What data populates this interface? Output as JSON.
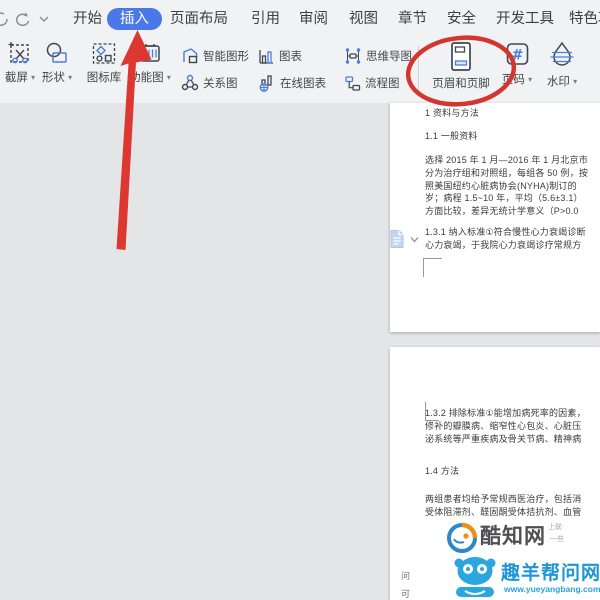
{
  "menubar": {
    "items": [
      {
        "label": "开始",
        "active": false
      },
      {
        "label": "插入",
        "active": true
      },
      {
        "label": "页面布局",
        "active": false
      },
      {
        "label": "引用",
        "active": false
      },
      {
        "label": "审阅",
        "active": false
      },
      {
        "label": "视图",
        "active": false
      },
      {
        "label": "章节",
        "active": false
      },
      {
        "label": "安全",
        "active": false
      },
      {
        "label": "开发工具",
        "active": false
      },
      {
        "label": "特色功能",
        "active": false
      }
    ]
  },
  "ui": {
    "caret": "▾"
  },
  "ribbon": {
    "screenshot": "截屏",
    "shapes": "形状",
    "icon_library": "图标库",
    "function_diagram": "功能图",
    "smart_graphics": "智能图形",
    "relationship": "关系图",
    "chart": "图表",
    "online_chart": "在线图表",
    "mind_map": "思维导图",
    "flowchart": "流程图",
    "header_footer": "页眉和页脚",
    "page_number": "页码",
    "watermark": "水印"
  },
  "document": {
    "page1": {
      "lines": [
        "1 资料与方法",
        "1.1 一般资料",
        "选择 2015 年 1 月—2016 年 1 月北京市",
        "分为治疗组和对照组，每组各 50 例，按",
        "照美国纽约心脏病协会(NYHA)制订的",
        "岁；病程 1.5~10 年，平均（5.6±3.1）",
        "方面比较，差异无统计学意义（P>0.0",
        "1.3.1 纳入标准①符合慢性心力衰竭诊断",
        "心力衰竭，于我院心力衰竭诊疗常规方"
      ]
    },
    "page2": {
      "lines": [
        "1.3.2 排除标准①能增加病死率的因素，",
        "修补的瓣膜病、缩窄性心包炎、心脏压",
        "泌系统等严重疾病及骨关节病、精神病",
        "1.4 方法",
        "两组患者均给予常规西医治疗，包括消",
        "受体阻滞剂、醛固酮受体拮抗剂、血管"
      ]
    }
  },
  "watermarks": {
    "kuzhi": {
      "name": "酷知网",
      "side_line1": "上联",
      "side_line2": "一些"
    },
    "yueyangbang": {
      "name": "趣羊帮问网",
      "url": "www.yueyangbang.com"
    },
    "stray1": "问",
    "stray2": "可"
  },
  "colors": {
    "accent_blue": "#4a78e8",
    "annotation_red": "#d93a32",
    "icon_blue": "#4c7ce0",
    "icon_dark": "#3e4650",
    "watermark_blue": "#2aa4dc"
  }
}
